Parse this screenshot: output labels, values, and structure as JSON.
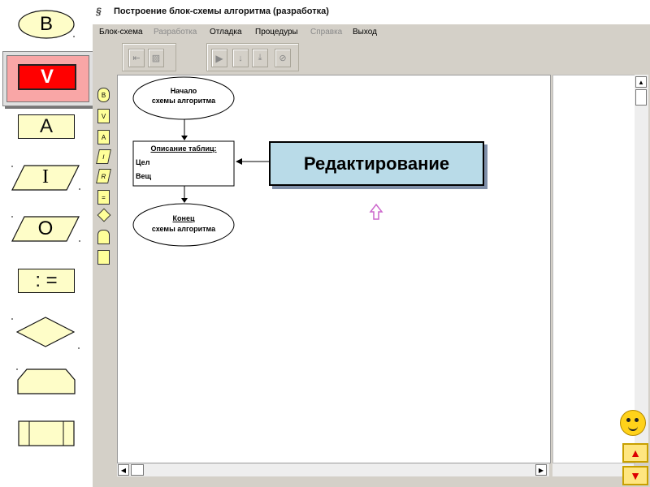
{
  "left_panel": {
    "buttons": [
      {
        "label": "B"
      },
      {
        "label": "V"
      },
      {
        "label": "A"
      },
      {
        "label": "I"
      },
      {
        "label": "O"
      },
      {
        "label": ": ="
      }
    ]
  },
  "window": {
    "title": "Построение блок-схемы алгоритма (разработка)",
    "menu": [
      {
        "label": "Блок-схема",
        "enabled": true
      },
      {
        "label": "Разработка",
        "enabled": false
      },
      {
        "label": "Отладка",
        "enabled": true
      },
      {
        "label": "Процедуры",
        "enabled": true
      },
      {
        "label": "Справка",
        "enabled": false
      },
      {
        "label": "Выход",
        "enabled": true
      }
    ]
  },
  "flowchart": {
    "start_line1": "Начало",
    "start_line2": "схемы алгоритма",
    "desc_title": "Описание таблиц:",
    "desc_item1": "Цел",
    "desc_item2": "Вещ",
    "end_line1": "Конец",
    "end_line2": "схемы алгоритма"
  },
  "callout": "Редактирование",
  "palette": [
    "B",
    "V",
    "A",
    "I",
    "R",
    "=",
    "",
    "",
    ""
  ],
  "colors": {
    "yellow": "#fefdc8",
    "callout": "#b9dbe8",
    "selected": "#f9a6a6"
  }
}
